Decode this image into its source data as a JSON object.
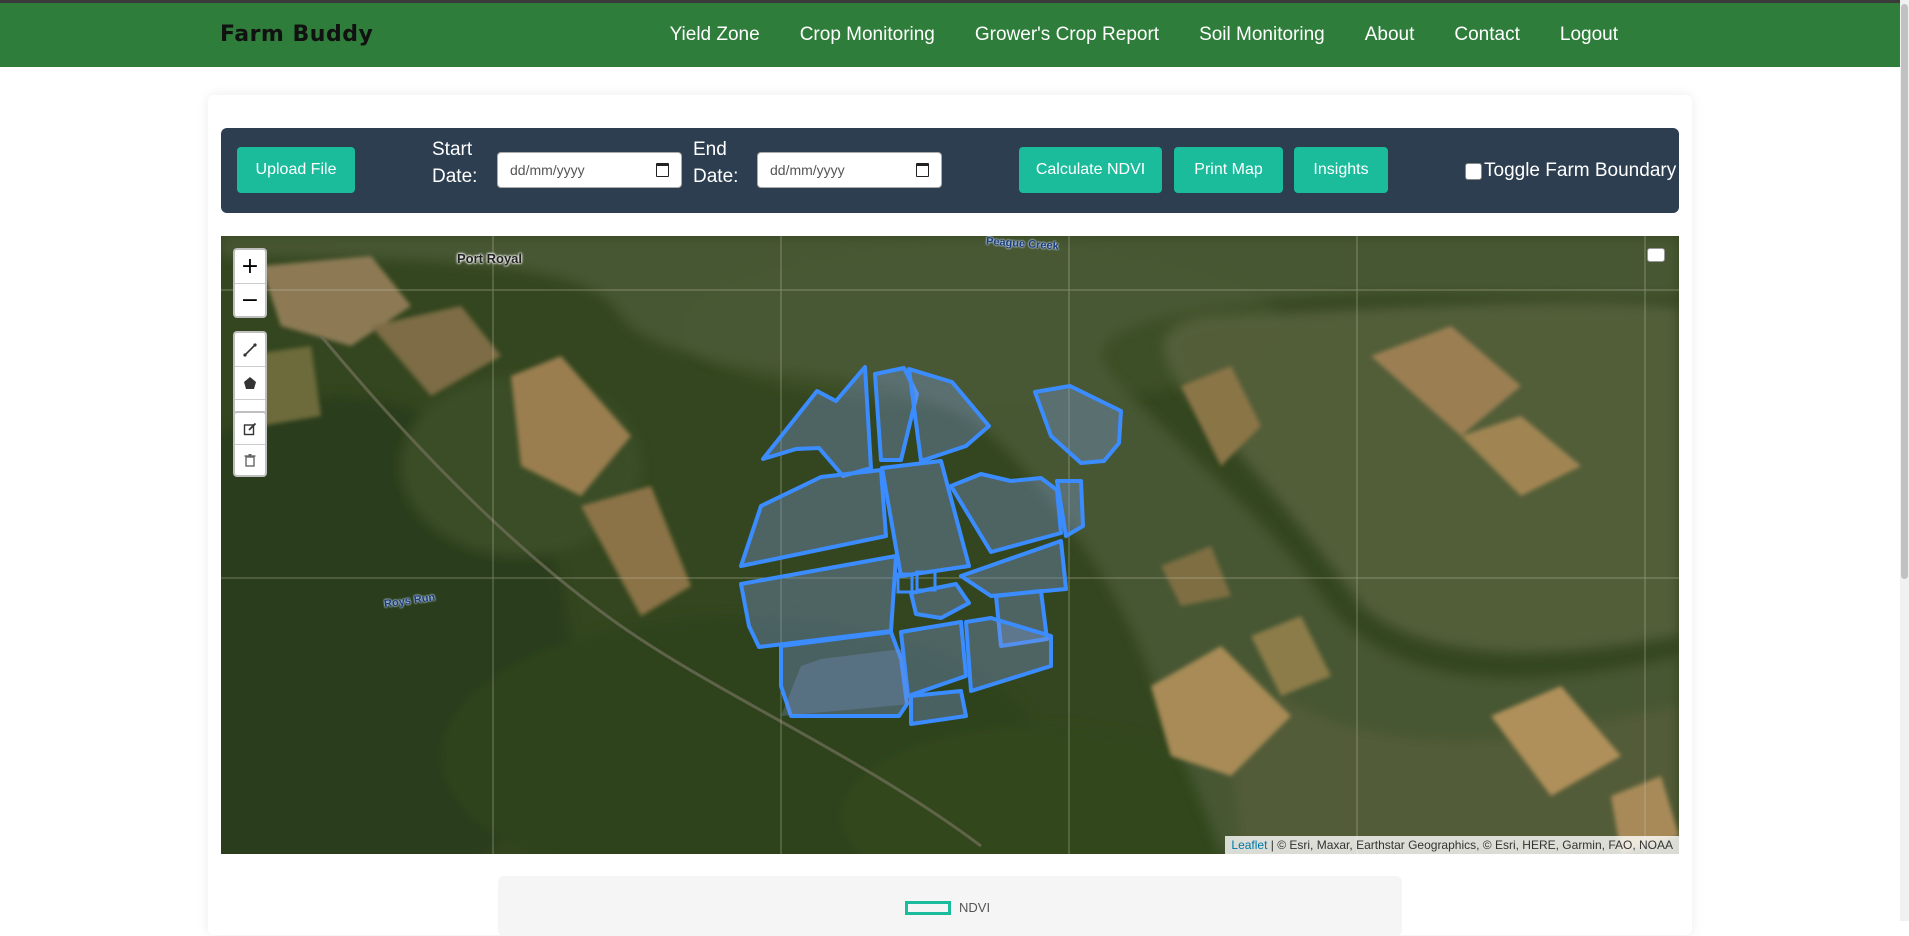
{
  "navbar": {
    "brand": "Farm Buddy",
    "links": [
      "Yield Zone",
      "Crop Monitoring",
      "Grower's Crop Report",
      "Soil Monitoring",
      "About",
      "Contact",
      "Logout"
    ]
  },
  "toolbar": {
    "upload_label": "Upload File",
    "start_label_1": "Start",
    "start_label_2": "Date:",
    "start_placeholder": "dd/mm/yyyy",
    "end_label_1": "End",
    "end_label_2": "Date:",
    "end_placeholder": "dd/mm/yyyy",
    "ndvi_label": "Calculate NDVI",
    "print_label": "Print Map",
    "insights_label": "Insights",
    "toggle_label": "Toggle Farm Boundary",
    "toggle_checked": false
  },
  "map": {
    "zoom_in": "+",
    "zoom_out": "−",
    "labels": {
      "port_royal": "Port Royal",
      "roys_run": "Roys Run",
      "creek": "Peague Creek"
    },
    "attribution_link": "Leaflet",
    "attribution_text": " | © Esri, Maxar, Earthstar Geographics, © Esri, HERE, Garmin, FAO, NOAA",
    "icons": [
      "polyline-icon",
      "polygon-icon",
      "rectangle-icon",
      "edit-icon",
      "trash-icon",
      "layers-icon"
    ]
  },
  "legend": {
    "label": "NDVI",
    "swatch_color": "#1abc9c"
  },
  "colors": {
    "navbar": "#2e7d3a",
    "toolbar": "#2c3e50",
    "accent": "#1abc9c",
    "field_outline": "#3b8cff"
  }
}
